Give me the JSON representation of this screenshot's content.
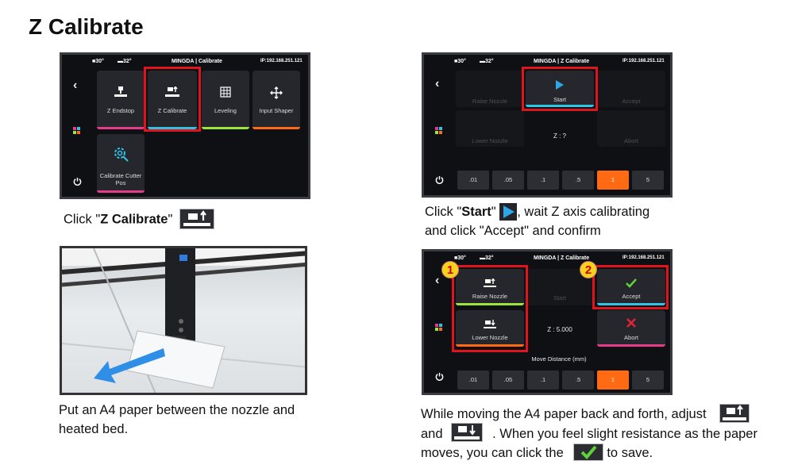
{
  "page_title": "Z Calibrate",
  "screen1": {
    "temp_nozzle": "30°",
    "temp_bed": "32°",
    "header_title": "MINGDA | Calibrate",
    "ip": "IP:192.168.251.121",
    "tiles": [
      {
        "label": "Z Endstop",
        "color": "#e63a8c"
      },
      {
        "label": "Z Calibrate",
        "color": "#2fc4e6"
      },
      {
        "label": "Leveling",
        "color": "#9be63a"
      },
      {
        "label": "Input Shaper",
        "color": "#ff6a13"
      },
      {
        "label": "Calibrate Cutter Pos",
        "color": "#e63a8c"
      }
    ]
  },
  "caption1": {
    "pre": "Click \"",
    "bold": "Z Calibrate",
    "post": "\""
  },
  "caption2": "Put an A4 paper between the nozzle and heated bed.",
  "screen2": {
    "temp_nozzle": "30°",
    "temp_bed": "32°",
    "header_title": "MINGDA | Z Calibrate",
    "ip": "IP:192.168.251.121",
    "raise_label": "Raise Nozzle",
    "lower_label": "Lower Nozzle",
    "start_label": "Start",
    "accept_label": "Accept",
    "abort_label": "Abort",
    "z_value": "Z : ?",
    "steps": [
      ".01",
      ".05",
      ".1",
      ".5",
      "1",
      "5"
    ],
    "active_step": "1"
  },
  "caption3": {
    "pre": "Click \"",
    "bold": "Start",
    "mid": "\"",
    "post": ", wait Z axis calibrating",
    "line2": "and click \"Accept\" and confirm"
  },
  "screen3": {
    "temp_nozzle": "30°",
    "temp_bed": "32°",
    "header_title": "MINGDA | Z Calibrate",
    "ip": "IP:192.168.251.121",
    "raise_label": "Raise Nozzle",
    "lower_label": "Lower Nozzle",
    "start_label": "Start",
    "accept_label": "Accept",
    "abort_label": "Abort",
    "z_value": "Z : 5.000",
    "move_distance": "Move Distance (mm)",
    "badge1": "1",
    "badge2": "2",
    "steps": [
      ".01",
      ".05",
      ".1",
      ".5",
      "1",
      "5"
    ],
    "active_step": "1"
  },
  "caption4": {
    "line1": "While moving the A4 paper back and forth, adjust",
    "line2_pre": "and",
    "line2_post": ". When you feel slight resistance as the paper",
    "line3_pre": "moves, you can click the",
    "line3_post": "to save."
  },
  "colors": {
    "highlight_red": "#e0141c",
    "accent_cyan": "#2fc4e6",
    "active_orange": "#ff6a13",
    "badge_yellow": "#f6d21c"
  }
}
